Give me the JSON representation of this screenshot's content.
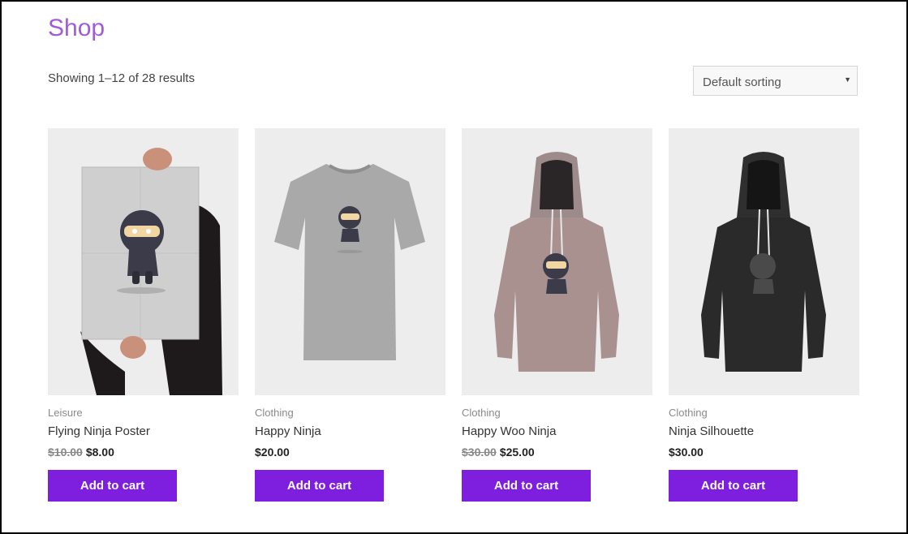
{
  "page": {
    "title": "Shop",
    "result_count": "Showing 1–12 of 28 results"
  },
  "sorting": {
    "selected": "Default sorting"
  },
  "products": [
    {
      "category": "Leisure",
      "name": "Flying Ninja Poster",
      "old_price": "$10.00",
      "price": "$8.00",
      "button": "Add to cart",
      "image": "poster-ninja-image"
    },
    {
      "category": "Clothing",
      "name": "Happy Ninja",
      "old_price": "",
      "price": "$20.00",
      "button": "Add to cart",
      "image": "tshirt-ninja-image"
    },
    {
      "category": "Clothing",
      "name": "Happy Woo Ninja",
      "old_price": "$30.00",
      "price": "$25.00",
      "button": "Add to cart",
      "image": "hoodie-pink-ninja-image"
    },
    {
      "category": "Clothing",
      "name": "Ninja Silhouette",
      "old_price": "",
      "price": "$30.00",
      "button": "Add to cart",
      "image": "hoodie-black-ninja-image"
    }
  ],
  "colors": {
    "accent": "#7e1fe0",
    "title": "#a05cd8",
    "thumb_bg": "#ededed"
  }
}
